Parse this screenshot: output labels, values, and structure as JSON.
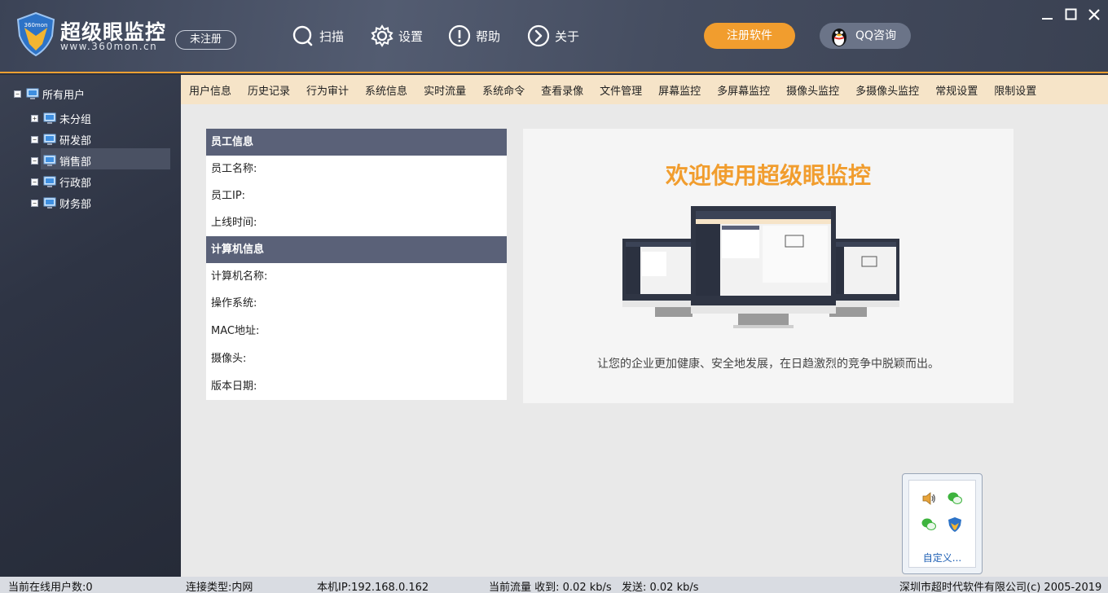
{
  "brand": {
    "title": "超级眼监控",
    "url": "www.360mon.cn",
    "unregistered": "未注册",
    "logo_text": "360mon"
  },
  "toolbar": [
    {
      "label": "扫描",
      "icon": "search-icon"
    },
    {
      "label": "设置",
      "icon": "gear-icon"
    },
    {
      "label": "帮助",
      "icon": "help-icon"
    },
    {
      "label": "关于",
      "icon": "about-icon"
    }
  ],
  "register_button": "注册软件",
  "qq_button": "QQ咨询",
  "tree": {
    "root": "所有用户",
    "groups": [
      "未分组",
      "研发部",
      "销售部",
      "行政部",
      "财务部"
    ],
    "selected": "销售部"
  },
  "tabs": [
    "用户信息",
    "历史记录",
    "行为审计",
    "系统信息",
    "实时流量",
    "系统命令",
    "查看录像",
    "文件管理",
    "屏幕监控",
    "多屏幕监控",
    "摄像头监控",
    "多摄像头监控",
    "常规设置",
    "限制设置"
  ],
  "employee": {
    "header": "员工信息",
    "fields": [
      "员工名称:",
      "员工IP:",
      "上线时间:"
    ]
  },
  "computer": {
    "header": "计算机信息",
    "fields": [
      "计算机名称:",
      "操作系统:",
      "MAC地址:",
      "摄像头:",
      "版本日期:"
    ]
  },
  "welcome": {
    "title": "欢迎使用超级眼监控",
    "subtitle": "让您的企业更加健康、安全地发展，在日趋激烈的竞争中脱颖而出。"
  },
  "tray": {
    "customize": "自定义..."
  },
  "status": {
    "online_users": "当前在线用户数:0",
    "connection": "连接类型:内网",
    "local_ip": "本机IP:192.168.0.162",
    "traffic_recv": "当前流量 收到: 0.02 kb/s",
    "traffic_send": "发送: 0.02 kb/s",
    "copyright": "深圳市超时代软件有限公司(c) 2005-2019"
  },
  "colors": {
    "accent": "#f19d2e",
    "header_bg": "#474f63",
    "tab_bg": "#f6e4c8",
    "section_head": "#5a6178"
  }
}
